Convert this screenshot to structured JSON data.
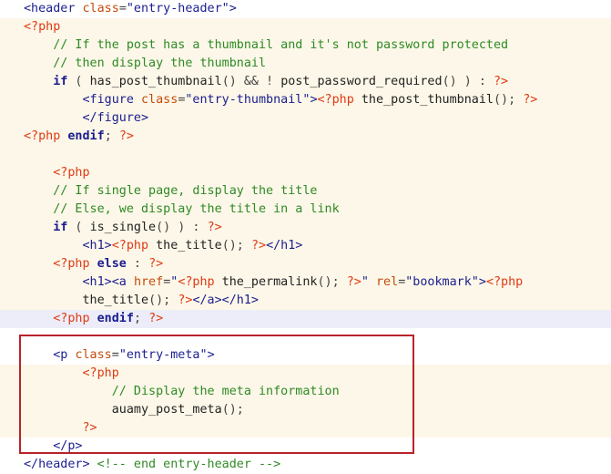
{
  "editor": {
    "lines": [
      {
        "cls": "html",
        "indent": "",
        "tokens": [
          [
            "t-tag",
            "<header "
          ],
          [
            "t-attr",
            "class"
          ],
          [
            "t-pun",
            "="
          ],
          [
            "t-str",
            "\"entry-header\""
          ],
          [
            "t-tag",
            ">"
          ]
        ]
      },
      {
        "cls": "php",
        "indent": "",
        "tokens": [
          [
            "t-php",
            "<?php"
          ]
        ]
      },
      {
        "cls": "php",
        "indent": "    ",
        "tokens": [
          [
            "t-cmt",
            "// If the post has a thumbnail and it's not password protected"
          ]
        ]
      },
      {
        "cls": "php",
        "indent": "    ",
        "tokens": [
          [
            "t-cmt",
            "// then display the thumbnail"
          ]
        ]
      },
      {
        "cls": "php",
        "indent": "    ",
        "tokens": [
          [
            "t-kw",
            "if"
          ],
          [
            "t-pun",
            " ( "
          ],
          [
            "t-fn",
            "has_post_thumbnail"
          ],
          [
            "t-pun",
            "() && ! "
          ],
          [
            "t-fn",
            "post_password_required"
          ],
          [
            "t-pun",
            "() ) : "
          ],
          [
            "t-php",
            "?>"
          ]
        ]
      },
      {
        "cls": "php",
        "indent": "        ",
        "tokens": [
          [
            "t-tag",
            "<figure "
          ],
          [
            "t-attr",
            "class"
          ],
          [
            "t-pun",
            "="
          ],
          [
            "t-str",
            "\"entry-thumbnail\""
          ],
          [
            "t-tag",
            ">"
          ],
          [
            "t-php",
            "<?php"
          ],
          [
            "t-fn",
            " the_post_thumbnail"
          ],
          [
            "t-pun",
            "(); "
          ],
          [
            "t-php",
            "?>"
          ]
        ]
      },
      {
        "cls": "php",
        "indent": "        ",
        "tokens": [
          [
            "t-tag",
            "</figure>"
          ]
        ]
      },
      {
        "cls": "php",
        "indent": "",
        "tokens": [
          [
            "t-php",
            "<?php "
          ],
          [
            "t-kw",
            "endif"
          ],
          [
            "t-pun",
            "; "
          ],
          [
            "t-php",
            "?>"
          ]
        ]
      },
      {
        "cls": "php",
        "indent": "",
        "tokens": []
      },
      {
        "cls": "php",
        "indent": "    ",
        "tokens": [
          [
            "t-php",
            "<?php"
          ]
        ]
      },
      {
        "cls": "php",
        "indent": "    ",
        "tokens": [
          [
            "t-cmt",
            "// If single page, display the title"
          ]
        ]
      },
      {
        "cls": "php",
        "indent": "    ",
        "tokens": [
          [
            "t-cmt",
            "// Else, we display the title in a link"
          ]
        ]
      },
      {
        "cls": "php",
        "indent": "    ",
        "tokens": [
          [
            "t-kw",
            "if"
          ],
          [
            "t-pun",
            " ( "
          ],
          [
            "t-fn",
            "is_single"
          ],
          [
            "t-pun",
            "() ) : "
          ],
          [
            "t-php",
            "?>"
          ]
        ]
      },
      {
        "cls": "php",
        "indent": "        ",
        "tokens": [
          [
            "t-tag",
            "<h1>"
          ],
          [
            "t-php",
            "<?php"
          ],
          [
            "t-fn",
            " the_title"
          ],
          [
            "t-pun",
            "(); "
          ],
          [
            "t-php",
            "?>"
          ],
          [
            "t-tag",
            "</h1>"
          ]
        ]
      },
      {
        "cls": "php",
        "indent": "    ",
        "tokens": [
          [
            "t-php",
            "<?php "
          ],
          [
            "t-kw",
            "else"
          ],
          [
            "t-pun",
            " : "
          ],
          [
            "t-php",
            "?>"
          ]
        ]
      },
      {
        "cls": "php",
        "indent": "        ",
        "tokens": [
          [
            "t-tag",
            "<h1><a "
          ],
          [
            "t-attr",
            "href"
          ],
          [
            "t-pun",
            "="
          ],
          [
            "t-str",
            "\""
          ],
          [
            "t-php",
            "<?php"
          ],
          [
            "t-fn",
            " the_permalink"
          ],
          [
            "t-pun",
            "(); "
          ],
          [
            "t-php",
            "?>"
          ],
          [
            "t-str",
            "\" "
          ],
          [
            "t-attr",
            "rel"
          ],
          [
            "t-pun",
            "="
          ],
          [
            "t-str",
            "\"bookmark\""
          ],
          [
            "t-tag",
            ">"
          ],
          [
            "t-php",
            "<?php"
          ]
        ]
      },
      {
        "cls": "php",
        "indent": "        ",
        "tokens": [
          [
            "t-fn",
            "the_title"
          ],
          [
            "t-pun",
            "(); "
          ],
          [
            "t-php",
            "?>"
          ],
          [
            "t-tag",
            "</a></h1>"
          ]
        ]
      },
      {
        "cls": "hl",
        "indent": "    ",
        "tokens": [
          [
            "t-php",
            "<?php "
          ],
          [
            "t-kw",
            "endif"
          ],
          [
            "t-pun",
            "; "
          ],
          [
            "t-php",
            "?>"
          ]
        ]
      },
      {
        "cls": "html",
        "indent": "",
        "tokens": []
      },
      {
        "cls": "html",
        "indent": "    ",
        "tokens": [
          [
            "t-tag",
            "<p "
          ],
          [
            "t-attr",
            "class"
          ],
          [
            "t-pun",
            "="
          ],
          [
            "t-str",
            "\"entry-meta\""
          ],
          [
            "t-tag",
            ">"
          ]
        ]
      },
      {
        "cls": "php",
        "indent": "        ",
        "tokens": [
          [
            "t-php",
            "<?php"
          ]
        ]
      },
      {
        "cls": "php",
        "indent": "            ",
        "tokens": [
          [
            "t-cmt",
            "// Display the meta information"
          ]
        ]
      },
      {
        "cls": "php",
        "indent": "            ",
        "tokens": [
          [
            "t-fn",
            "auamy_post_meta"
          ],
          [
            "t-pun",
            "();"
          ]
        ]
      },
      {
        "cls": "php",
        "indent": "        ",
        "tokens": [
          [
            "t-php",
            "?>"
          ]
        ]
      },
      {
        "cls": "html",
        "indent": "    ",
        "tokens": [
          [
            "t-tag",
            "</p>"
          ]
        ]
      },
      {
        "cls": "html",
        "indent": "",
        "tokens": [
          [
            "t-tag",
            "</header>"
          ],
          [
            "t-cmt",
            " <!-- end entry-header -->"
          ]
        ]
      }
    ]
  },
  "annotation": {
    "color": "#b8232a"
  }
}
